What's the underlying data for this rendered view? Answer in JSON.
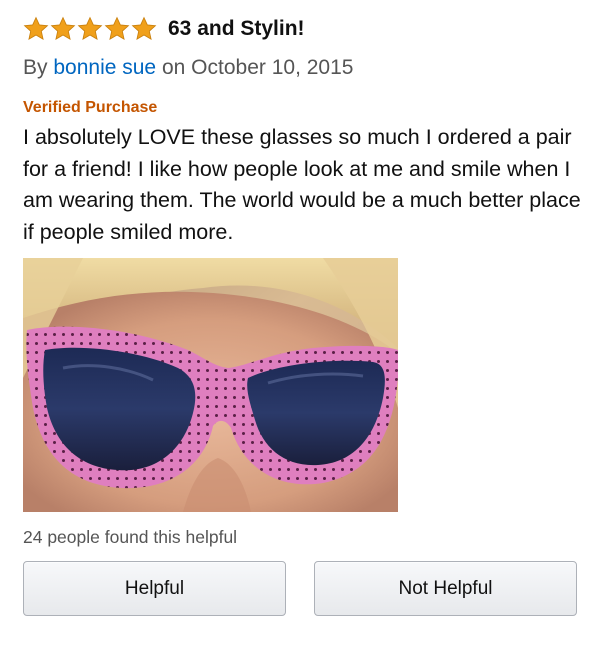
{
  "review": {
    "rating": 5,
    "max_rating": 5,
    "star_color": "#f0a01b",
    "title": "63 and Stylin!",
    "byline_prefix": "By",
    "author": "bonnie sue",
    "date_prefix": "on",
    "date": "October 10, 2015",
    "verified_label": "Verified Purchase",
    "verified_color": "#c45500",
    "body": "I absolutely LOVE these glasses so much I ordered a pair for a friend! I like how people look at me and smile when I am wearing them. The world would be a much better place if people smiled more.",
    "photo_icon": "customer-photo-sunglasses",
    "helpful_count_text": "24 people found this helpful"
  },
  "buttons": {
    "helpful_label": "Helpful",
    "not_helpful_label": "Not Helpful"
  },
  "colors": {
    "link": "#0066c0",
    "secondary_text": "#555555",
    "frame_pink": "#df7fbf"
  }
}
